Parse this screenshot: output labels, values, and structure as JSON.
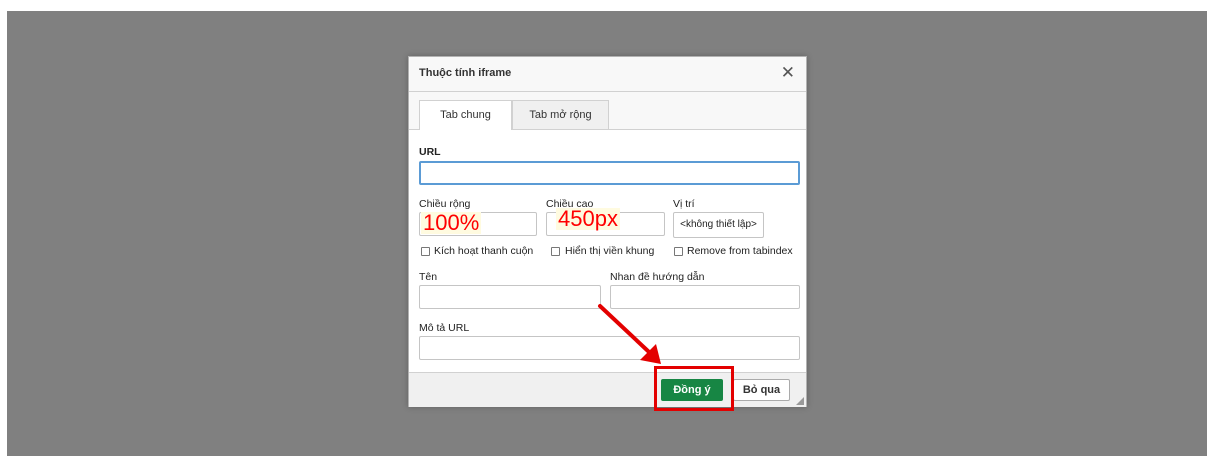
{
  "dialog": {
    "title": "Thuộc tính iframe",
    "close_symbol": "✕"
  },
  "tabs": [
    {
      "label": "Tab chung"
    },
    {
      "label": "Tab mở rộng"
    }
  ],
  "form": {
    "url_label": "URL",
    "url_value": "",
    "width_label": "Chiều rộng",
    "width_annotation": "100%",
    "height_label": "Chiều cao",
    "height_annotation": "450px",
    "position_label": "Vị trí",
    "position_value": "<không thiết lập>",
    "checkboxes": [
      {
        "label": "Kích hoạt thanh cuộn",
        "checked": false
      },
      {
        "label": "Hiển thị viền khung",
        "checked": false
      },
      {
        "label": "Remove from tabindex",
        "checked": false
      }
    ],
    "name_label": "Tên",
    "name_value": "",
    "title_label": "Nhan đề hướng dẫn",
    "title_value": "",
    "longdesc_label": "Mô tả URL",
    "longdesc_value": ""
  },
  "footer": {
    "ok_label": "Đồng ý",
    "cancel_label": "Bỏ qua"
  },
  "colors": {
    "overlay": "#808080",
    "ok_button": "#178644",
    "annotation_red": "#e30000",
    "focus_border": "#5b9bd5"
  }
}
